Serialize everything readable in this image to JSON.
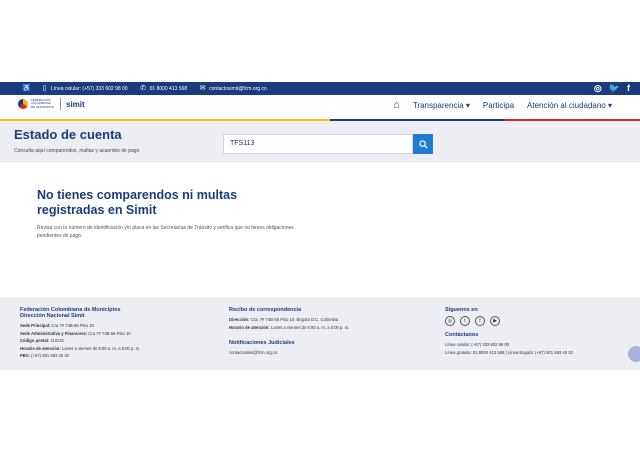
{
  "topbar": {
    "phone_cell": "Línea celular: (+57) 333 602 98 00",
    "phone_free": "01 8000 413 568",
    "email": "contactosimit@fcm.org.co",
    "social": [
      "◎",
      "🐦",
      "f"
    ]
  },
  "header": {
    "logo_text": "FEDERACIÓN COLOMBIANA DE MUNICIPIOS",
    "logo_brand": "simit",
    "nav": {
      "transparencia": "Transparencia ▾",
      "participa": "Participa",
      "atencion": "Atención al ciudadano ▾"
    }
  },
  "estado": {
    "title": "Estado de cuenta",
    "subtitle": "Consulta aquí comparendos, multas y acuerdos de pago",
    "search_value": "TFS113"
  },
  "message": {
    "title": "No tienes comparendos ni multas registradas en Simit",
    "body": "Revisa con tu número de identificación y/o placa en las Secretarías de Tránsito y verifica que no tienes obligaciones pendientes de pago."
  },
  "footer": {
    "col1": {
      "title": "Federación Colombiana de Municipios Dirección Nacional Simit",
      "lines": [
        {
          "label": "Sede Principal:",
          "text": " Cra 7# 74B-56 Piso 10"
        },
        {
          "label": "Sede Administrativa y Financiera:",
          "text": " Cra 7# 74B-56 Piso 10"
        },
        {
          "label": "Código postal:",
          "text": " 110231"
        },
        {
          "label": "Horario de atención:",
          "text": " Lunes a viernes de 8:00 a. m. a 5:00 p. m."
        },
        {
          "label": "PBX:",
          "text": " (+57) 601 593 40 20"
        }
      ]
    },
    "col2": {
      "title": "Recibo de correspondencia",
      "lines": [
        {
          "label": "Dirección:",
          "text": " Cra. 7# 74B-56 Piso 10. Bogotá D.C. Colombia"
        },
        {
          "label": "Horario de atención:",
          "text": " Lunes a viernes de 8:00 a. m. a 5:00 p. m."
        }
      ],
      "title2": "Notificaciones Judiciales",
      "email": "contactosimit@fcm.org.co"
    },
    "col3": {
      "title": "Síguenos en",
      "icons": [
        "◎",
        "t",
        "f",
        "▶"
      ],
      "title2": "Contáctanos",
      "lines": [
        "Línea celular: (+57) 333 602 98 00",
        "Línea gratuita: 01 8000 413 568 | Línea Bogotá: (+57) 601 593 40 20"
      ]
    }
  },
  "colors": {
    "primary": "#1a3c7e",
    "button": "#1f7cd3",
    "yellow": "#f4c20d",
    "red": "#d52b1e"
  }
}
